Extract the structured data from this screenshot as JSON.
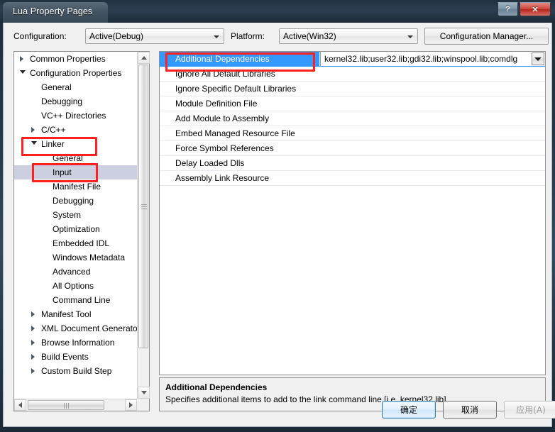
{
  "window": {
    "title": "Lua Property Pages",
    "help_button": "?",
    "close_button": "✕"
  },
  "toolbar": {
    "configuration_label": "Configuration:",
    "configuration_value": "Active(Debug)",
    "platform_label": "Platform:",
    "platform_value": "Active(Win32)",
    "configuration_manager_button": "Configuration Manager..."
  },
  "tree": {
    "items": [
      {
        "label": "Common Properties",
        "level": 0,
        "state": "collapsed",
        "selected": false
      },
      {
        "label": "Configuration Properties",
        "level": 0,
        "state": "expanded",
        "selected": false
      },
      {
        "label": "General",
        "level": 1,
        "state": "leaf",
        "selected": false
      },
      {
        "label": "Debugging",
        "level": 1,
        "state": "leaf",
        "selected": false
      },
      {
        "label": "VC++ Directories",
        "level": 1,
        "state": "leaf",
        "selected": false
      },
      {
        "label": "C/C++",
        "level": 1,
        "state": "collapsed",
        "selected": false
      },
      {
        "label": "Linker",
        "level": 1,
        "state": "expanded",
        "selected": false
      },
      {
        "label": "General",
        "level": 2,
        "state": "leaf",
        "selected": false
      },
      {
        "label": "Input",
        "level": 2,
        "state": "leaf",
        "selected": true
      },
      {
        "label": "Manifest File",
        "level": 2,
        "state": "leaf",
        "selected": false
      },
      {
        "label": "Debugging",
        "level": 2,
        "state": "leaf",
        "selected": false
      },
      {
        "label": "System",
        "level": 2,
        "state": "leaf",
        "selected": false
      },
      {
        "label": "Optimization",
        "level": 2,
        "state": "leaf",
        "selected": false
      },
      {
        "label": "Embedded IDL",
        "level": 2,
        "state": "leaf",
        "selected": false
      },
      {
        "label": "Windows Metadata",
        "level": 2,
        "state": "leaf",
        "selected": false
      },
      {
        "label": "Advanced",
        "level": 2,
        "state": "leaf",
        "selected": false
      },
      {
        "label": "All Options",
        "level": 2,
        "state": "leaf",
        "selected": false
      },
      {
        "label": "Command Line",
        "level": 2,
        "state": "leaf",
        "selected": false
      },
      {
        "label": "Manifest Tool",
        "level": 1,
        "state": "collapsed",
        "selected": false
      },
      {
        "label": "XML Document Generator",
        "level": 1,
        "state": "collapsed",
        "selected": false
      },
      {
        "label": "Browse Information",
        "level": 1,
        "state": "collapsed",
        "selected": false
      },
      {
        "label": "Build Events",
        "level": 1,
        "state": "collapsed",
        "selected": false
      },
      {
        "label": "Custom Build Step",
        "level": 1,
        "state": "collapsed",
        "selected": false
      }
    ]
  },
  "grid": {
    "rows": [
      {
        "name": "Additional Dependencies",
        "value": "kernel32.lib;user32.lib;gdi32.lib;winspool.lib;comdlg",
        "selected": true,
        "has_dropdown": true
      },
      {
        "name": "Ignore All Default Libraries",
        "value": "",
        "selected": false,
        "has_dropdown": false
      },
      {
        "name": "Ignore Specific Default Libraries",
        "value": "",
        "selected": false,
        "has_dropdown": false
      },
      {
        "name": "Module Definition File",
        "value": "",
        "selected": false,
        "has_dropdown": false
      },
      {
        "name": "Add Module to Assembly",
        "value": "",
        "selected": false,
        "has_dropdown": false
      },
      {
        "name": "Embed Managed Resource File",
        "value": "",
        "selected": false,
        "has_dropdown": false
      },
      {
        "name": "Force Symbol References",
        "value": "",
        "selected": false,
        "has_dropdown": false
      },
      {
        "name": "Delay Loaded Dlls",
        "value": "",
        "selected": false,
        "has_dropdown": false
      },
      {
        "name": "Assembly Link Resource",
        "value": "",
        "selected": false,
        "has_dropdown": false
      }
    ]
  },
  "description": {
    "title": "Additional Dependencies",
    "body": "Specifies additional items to add to the link command line [i.e. kernel32.lib]"
  },
  "footer": {
    "ok_label": "确定",
    "cancel_label": "取消",
    "apply_label": "应用(A)"
  },
  "colors": {
    "selection_blue": "#3399ff",
    "tree_selection": "#cbcfe0",
    "annotation_red": "#ff2020",
    "titlebar_dark": "#22313f"
  }
}
